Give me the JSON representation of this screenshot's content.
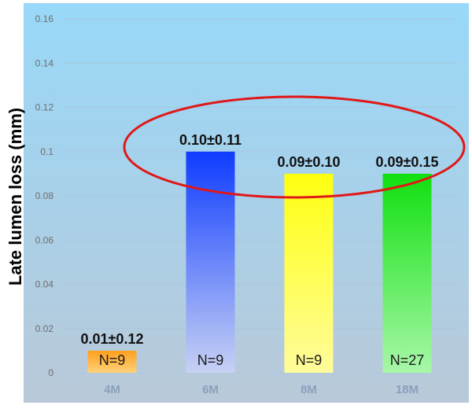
{
  "chart_data": {
    "type": "bar",
    "categories": [
      "4M",
      "6M",
      "8M",
      "18M"
    ],
    "values": [
      0.01,
      0.1,
      0.09,
      0.09
    ],
    "value_labels": [
      "0.01±0.12",
      "0.10±0.11",
      "0.09±0.10",
      "0.09±0.15"
    ],
    "n_labels": [
      "N=9",
      "N=9",
      "N=9",
      "N=27"
    ],
    "title": "",
    "xlabel": "",
    "ylabel": "Late lumen loss (mm)",
    "ylim": [
      0,
      0.16
    ],
    "yticks": [
      {
        "value": 0,
        "label": "0"
      },
      {
        "value": 0.02,
        "label": "0.02"
      },
      {
        "value": 0.04,
        "label": "0.04"
      },
      {
        "value": 0.06,
        "label": "0.06"
      },
      {
        "value": 0.08,
        "label": "0.08"
      },
      {
        "value": 0.1,
        "label": "0.1"
      },
      {
        "value": 0.12,
        "label": "0.12"
      },
      {
        "value": 0.14,
        "label": "0.14"
      },
      {
        "value": 0.16,
        "label": "0.16"
      }
    ],
    "grid": true,
    "legend": "none",
    "bar_colors": [
      {
        "top": "#ff9f1c",
        "bottom": "#ffd27a"
      },
      {
        "top": "#0f3cff",
        "bottom": "#c7d1f4"
      },
      {
        "top": "#ffff10",
        "bottom": "#fffc9a"
      },
      {
        "top": "#10e010",
        "bottom": "#a8f7a8"
      }
    ],
    "annotation": {
      "shape": "ellipse",
      "color": "#e01818",
      "highlights": [
        "6M",
        "8M",
        "18M"
      ]
    },
    "background_gradient": {
      "top": "#98d8f8",
      "bottom": "#b9c9d9"
    }
  }
}
